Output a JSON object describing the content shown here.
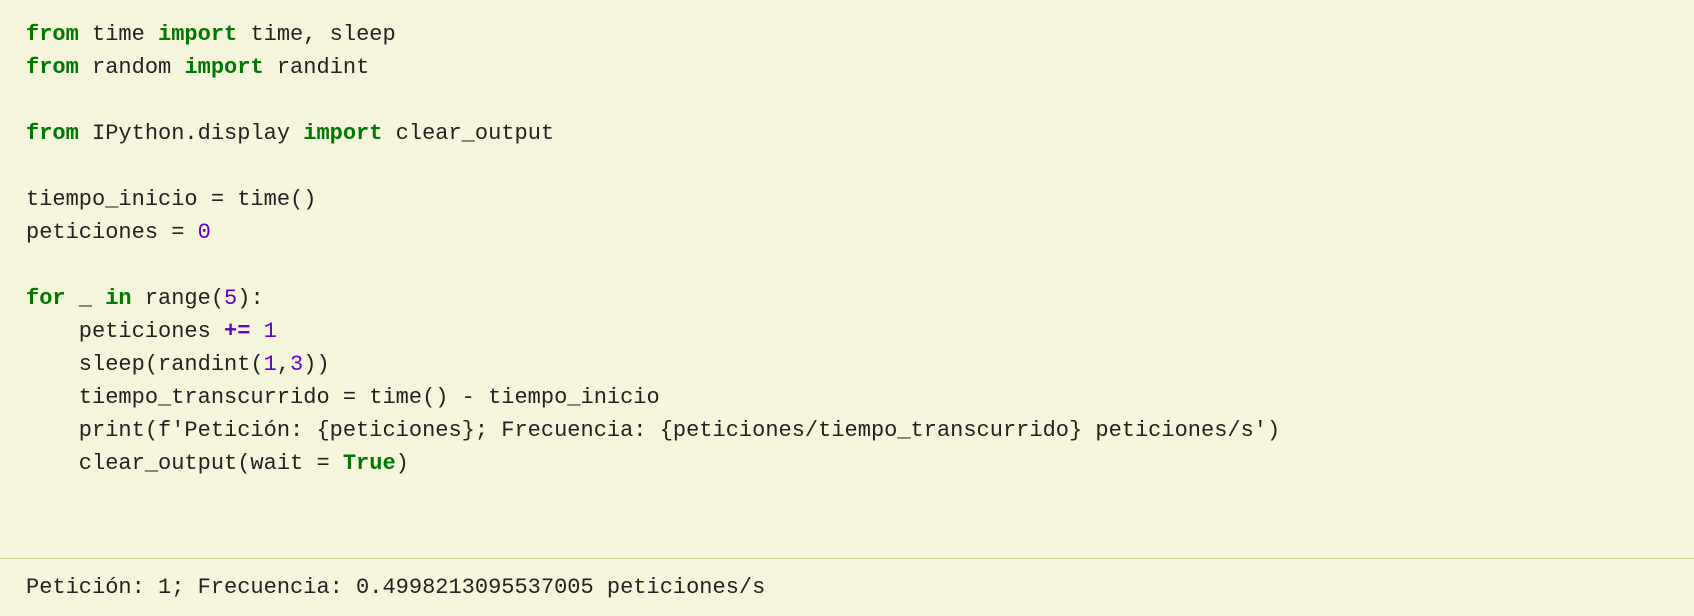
{
  "code": {
    "lines": [
      {
        "id": "line1",
        "parts": [
          {
            "type": "keyword",
            "text": "from"
          },
          {
            "type": "normal",
            "text": " time "
          },
          {
            "type": "keyword",
            "text": "import"
          },
          {
            "type": "normal",
            "text": " time, sleep"
          }
        ]
      },
      {
        "id": "line2",
        "parts": [
          {
            "type": "keyword",
            "text": "from"
          },
          {
            "type": "normal",
            "text": " random "
          },
          {
            "type": "keyword",
            "text": "import"
          },
          {
            "type": "normal",
            "text": " randint"
          }
        ]
      },
      {
        "id": "line3",
        "parts": []
      },
      {
        "id": "line4",
        "parts": [
          {
            "type": "keyword",
            "text": "from"
          },
          {
            "type": "normal",
            "text": " IPython.display "
          },
          {
            "type": "keyword",
            "text": "import"
          },
          {
            "type": "normal",
            "text": " clear_output"
          }
        ]
      },
      {
        "id": "line5",
        "parts": []
      },
      {
        "id": "line6",
        "parts": [
          {
            "type": "normal",
            "text": "tiempo_inicio = time()"
          }
        ]
      },
      {
        "id": "line7",
        "parts": [
          {
            "type": "normal",
            "text": "peticiones = "
          },
          {
            "type": "number",
            "text": "0"
          }
        ]
      },
      {
        "id": "line8",
        "parts": []
      },
      {
        "id": "line9",
        "parts": [
          {
            "type": "keyword",
            "text": "for"
          },
          {
            "type": "normal",
            "text": " _ "
          },
          {
            "type": "keyword",
            "text": "in"
          },
          {
            "type": "normal",
            "text": " range("
          },
          {
            "type": "number",
            "text": "5"
          },
          {
            "type": "normal",
            "text": "):"
          }
        ]
      },
      {
        "id": "line10",
        "parts": [
          {
            "type": "indent",
            "text": "    "
          },
          {
            "type": "normal",
            "text": "peticiones "
          },
          {
            "type": "augmented",
            "text": "+="
          },
          {
            "type": "normal",
            "text": " "
          },
          {
            "type": "number",
            "text": "1"
          }
        ]
      },
      {
        "id": "line11",
        "parts": [
          {
            "type": "indent",
            "text": "    "
          },
          {
            "type": "normal",
            "text": "sleep(randint("
          },
          {
            "type": "number",
            "text": "1"
          },
          {
            "type": "normal",
            "text": ","
          },
          {
            "type": "number",
            "text": "3"
          },
          {
            "type": "normal",
            "text": "))"
          }
        ]
      },
      {
        "id": "line12",
        "parts": [
          {
            "type": "indent",
            "text": "    "
          },
          {
            "type": "normal",
            "text": "tiempo_transcurrido = time() - tiempo_inicio"
          }
        ]
      },
      {
        "id": "line13",
        "parts": [
          {
            "type": "indent",
            "text": "    "
          },
          {
            "type": "normal",
            "text": "print(f'Petición: {peticiones}; Frecuencia: {peticiones/tiempo_transcurrido} peticiones/s')"
          }
        ]
      },
      {
        "id": "line14",
        "parts": [
          {
            "type": "indent",
            "text": "    "
          },
          {
            "type": "normal",
            "text": "clear_output(wait = "
          },
          {
            "type": "keyword",
            "text": "True"
          },
          {
            "type": "normal",
            "text": ")"
          }
        ]
      }
    ],
    "output": "Petición: 1; Frecuencia: 0.499821309553700​5 peticiones/s"
  }
}
